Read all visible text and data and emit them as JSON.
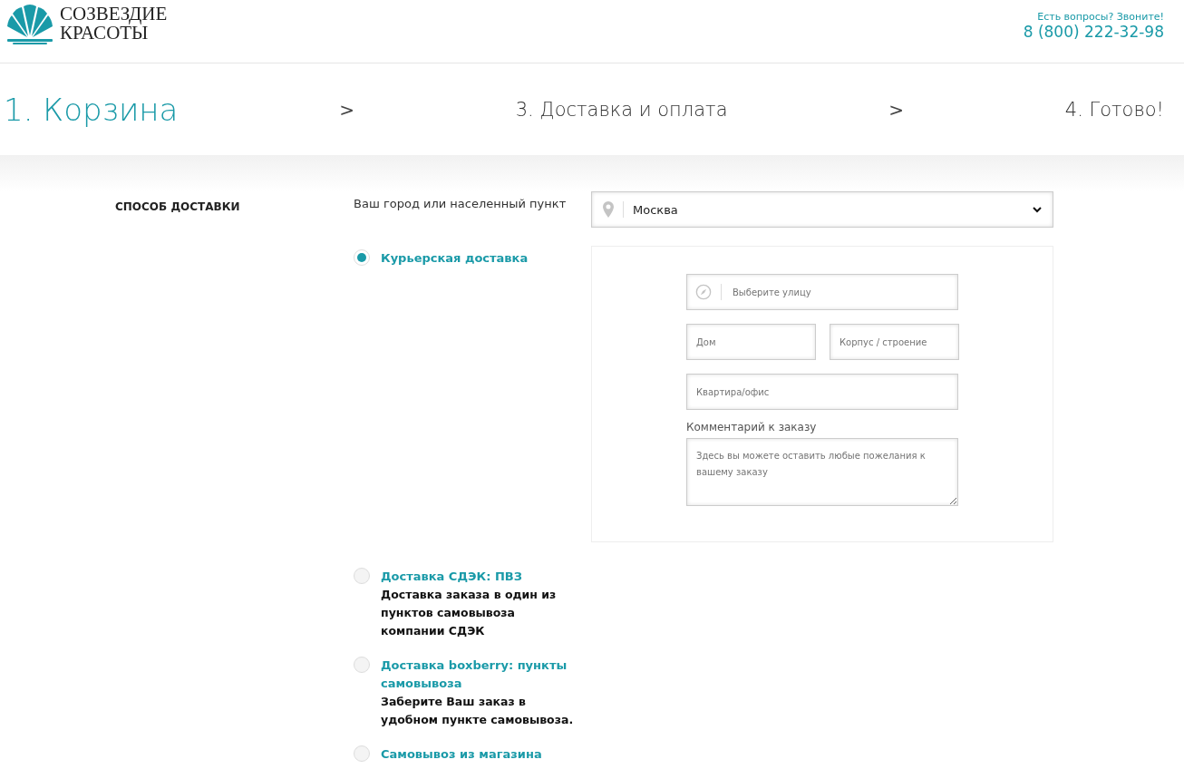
{
  "header": {
    "logo_line1": "СОЗВЕЗДИЕ",
    "logo_line2": "КРАСОТЫ",
    "contact_prompt": "Есть вопросы? Звоните!",
    "phone": "8 (800) 222-32-98"
  },
  "steps": [
    {
      "label": "1. Корзина",
      "selected": true
    },
    {
      "label": ">",
      "kind": "separator"
    },
    {
      "label": "3. Доставка и оплата",
      "selected": false
    },
    {
      "label": ">",
      "kind": "separator"
    },
    {
      "label": "4. Готово!",
      "selected": false
    }
  ],
  "section_title": "СПОСОБ ДОСТАВКИ",
  "city": {
    "label": "Ваш город или населенный пункт",
    "value": "Москва"
  },
  "delivery_options": [
    {
      "title": "Курьерская доставка",
      "selected": true
    },
    {
      "title": "Доставка СДЭК: ПВЗ",
      "description": "Доставка заказа в один из пунктов самовывоза компании СДЭК",
      "selected": false
    },
    {
      "title": "Доставка boxberry: пункты самовывоза",
      "description": "Заберите Ваш заказ в удобном пункте самовывоза.",
      "selected": false
    },
    {
      "title": "Самовывоз из магазина",
      "selected": false
    }
  ],
  "courier_form": {
    "street_placeholder": "Выберите улицу",
    "house_placeholder": "Дом",
    "building_placeholder": "Корпус / строение",
    "apartment_placeholder": "Квартира/офис",
    "comment_label": "Комментарий к заказу",
    "comment_placeholder": "Здесь вы можете оставить любые пожелания к вашему заказу"
  }
}
